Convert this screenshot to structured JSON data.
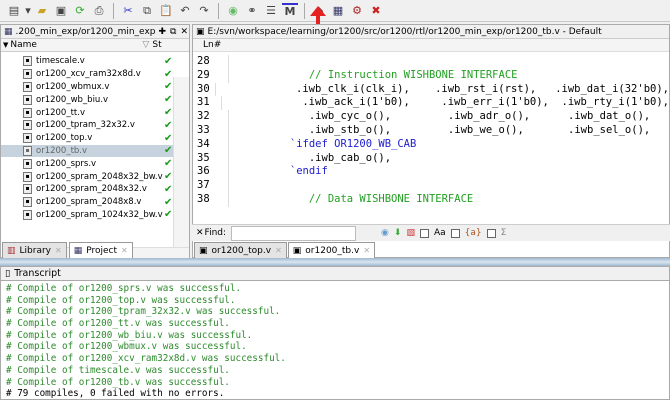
{
  "toolbar": {
    "icons": [
      "new-file-icon",
      "dropdown-icon",
      "open-folder-icon",
      "save-icon",
      "refresh-icon",
      "print-icon",
      "cut-icon",
      "copy-icon",
      "paste-icon",
      "undo-icon",
      "redo-icon",
      "compile-icon",
      "find-binoculars-icon",
      "list-icon",
      "m-icon",
      "compile-all-icon",
      "library-icon",
      "simulate-icon",
      "break-icon"
    ],
    "annotation_color": "#e52222"
  },
  "left_panel": {
    "title": ".200_min_exp/or1200_min_exp",
    "col_name": "Name",
    "col_status": "St",
    "files": [
      {
        "name": "timescale.v"
      },
      {
        "name": "or1200_xcv_ram32x8d.v"
      },
      {
        "name": "or1200_wbmux.v"
      },
      {
        "name": "or1200_wb_biu.v"
      },
      {
        "name": "or1200_tt.v"
      },
      {
        "name": "or1200_tpram_32x32.v"
      },
      {
        "name": "or1200_top.v"
      },
      {
        "name": "or1200_tb.v",
        "selected": true
      },
      {
        "name": "or1200_sprs.v"
      },
      {
        "name": "or1200_spram_2048x32_bw.v"
      },
      {
        "name": "or1200_spram_2048x32.v"
      },
      {
        "name": "or1200_spram_2048x8.v"
      },
      {
        "name": "or1200_spram_1024x32_bw.v"
      }
    ],
    "tabs": [
      {
        "label": "Library"
      },
      {
        "label": "Project",
        "active": true
      }
    ]
  },
  "editor": {
    "title": "E:/svn/workspace/learning/or1200/src/or1200/rtl/or1200_min_exp/or1200_tb.v - Default",
    "ln_header": "Ln#",
    "lines": [
      {
        "n": "28",
        "text": "",
        "type": "code"
      },
      {
        "n": "29",
        "text": "            // Instruction WISHBONE INTERFACE",
        "type": "comment"
      },
      {
        "n": "30",
        "text": "            .iwb_clk_i(clk_i),    .iwb_rst_i(rst),   .iwb_dat_i(32'b0),",
        "type": "code"
      },
      {
        "n": "31",
        "text": "            .iwb_ack_i(1'b0),     .iwb_err_i(1'b0),  .iwb_rty_i(1'b0),",
        "type": "code"
      },
      {
        "n": "32",
        "text": "            .iwb_cyc_o(),         .iwb_adr_o(),      .iwb_dat_o(),",
        "type": "code"
      },
      {
        "n": "33",
        "text": "            .iwb_stb_o(),         .iwb_we_o(),       .iwb_sel_o(),",
        "type": "code"
      },
      {
        "n": "34",
        "text": "         `ifdef OR1200_WB_CAB",
        "type": "keyword"
      },
      {
        "n": "35",
        "text": "            .iwb_cab_o(),",
        "type": "code"
      },
      {
        "n": "36",
        "text": "         `endif",
        "type": "keyword"
      },
      {
        "n": "37",
        "text": "",
        "type": "code"
      },
      {
        "n": "38",
        "text": "            // Data WISHBONE INTERFACE",
        "type": "comment"
      }
    ],
    "find_label": "Find:",
    "find_value": "",
    "option_case": "Aa",
    "option_regex": "{a}",
    "option_sigma": "Σ",
    "tabs": [
      {
        "label": "or1200_top.v"
      },
      {
        "label": "or1200_tb.v",
        "active": true
      }
    ]
  },
  "transcript": {
    "title": "Transcript",
    "lines": [
      "# Compile of or1200_sprs.v was successful.",
      "# Compile of or1200_top.v was successful.",
      "# Compile of or1200_tpram_32x32.v was successful.",
      "# Compile of or1200_tt.v was successful.",
      "# Compile of or1200_wb_biu.v was successful.",
      "# Compile of or1200_wbmux.v was successful.",
      "# Compile of or1200_xcv_ram32x8d.v was successful.",
      "# Compile of timescale.v was successful.",
      "# Compile of or1200_tb.v was successful."
    ],
    "summary": "# 79 compiles, 0 failed with no errors."
  }
}
